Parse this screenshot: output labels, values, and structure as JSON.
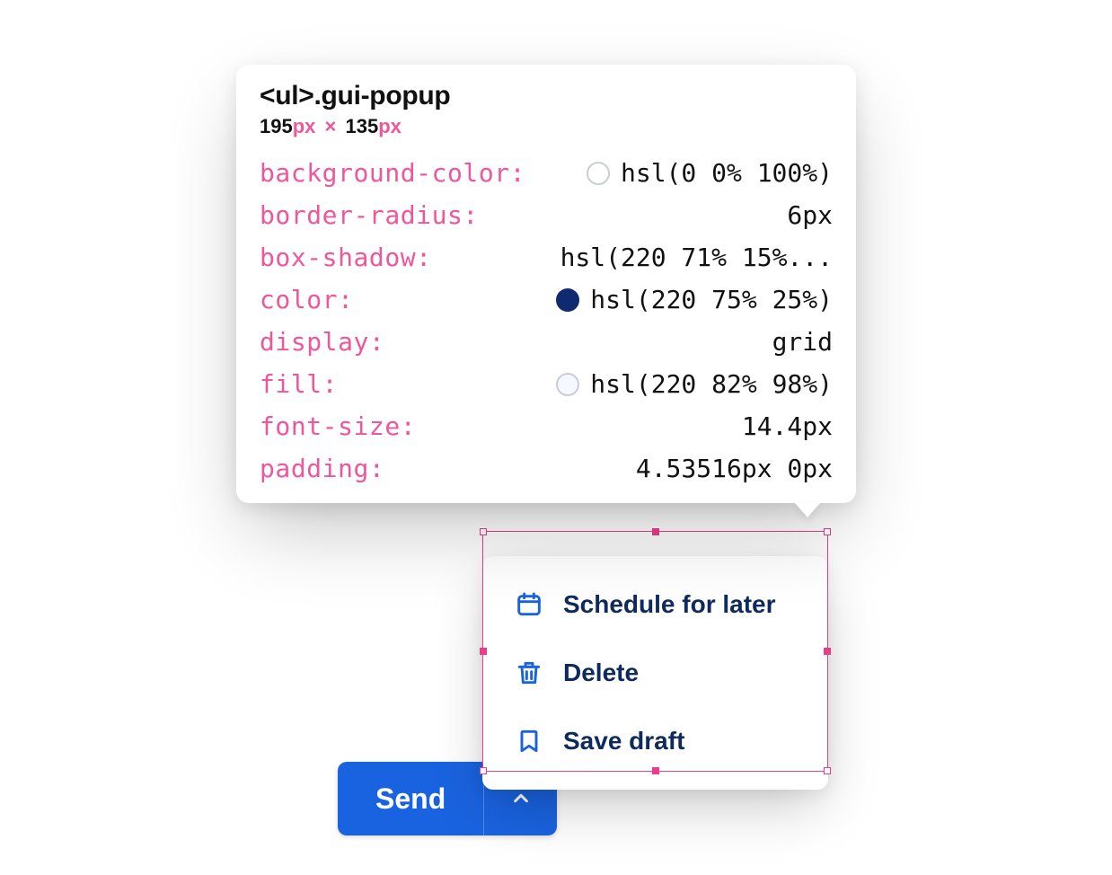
{
  "send_button": {
    "label": "Send"
  },
  "popup": {
    "items": [
      {
        "icon": "calendar-icon",
        "label": "Schedule for later"
      },
      {
        "icon": "trash-icon",
        "label": "Delete"
      },
      {
        "icon": "bookmark-icon",
        "label": "Save draft"
      }
    ]
  },
  "tooltip": {
    "selector": "<ul>.gui-popup",
    "dims": {
      "w": "195",
      "h": "135",
      "unit": "px"
    },
    "rows": [
      {
        "prop": "background-color",
        "value": "hsl(0 0% 100%)",
        "swatch": "#ffffff"
      },
      {
        "prop": "border-radius",
        "value": "6px"
      },
      {
        "prop": "box-shadow",
        "value": "hsl(220 71% 15%..."
      },
      {
        "prop": "color",
        "value": "hsl(220 75% 25%)",
        "swatch": "#102a6f"
      },
      {
        "prop": "display",
        "value": "grid"
      },
      {
        "prop": "fill",
        "value": "hsl(220 82% 98%)",
        "swatch": "#f5f8fe"
      },
      {
        "prop": "font-size",
        "value": "14.4px"
      },
      {
        "prop": "padding",
        "value": "4.53516px 0px"
      }
    ]
  }
}
